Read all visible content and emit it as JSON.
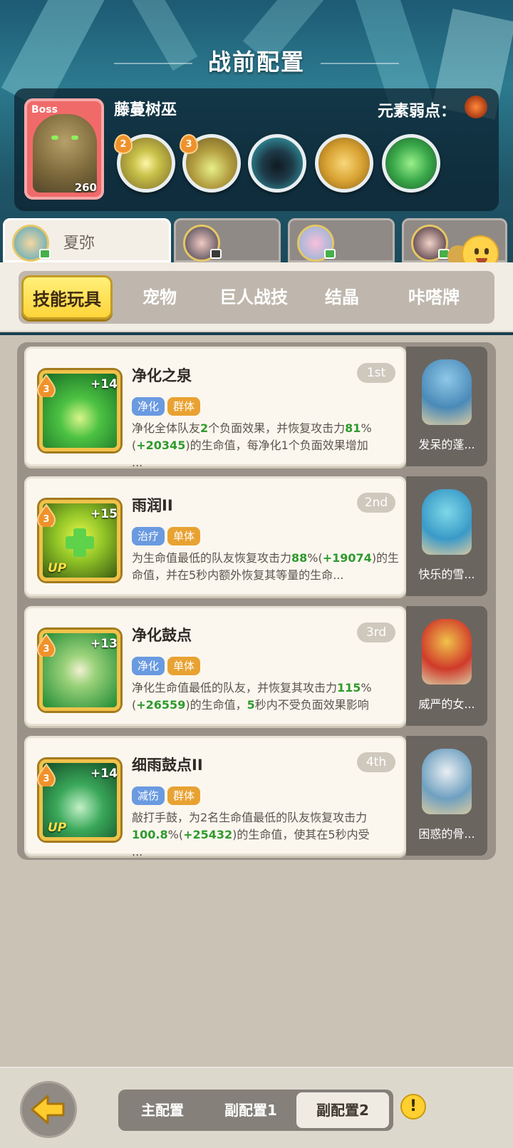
{
  "header": {
    "title": "战前配置"
  },
  "boss": {
    "tag": "Boss",
    "level": "260",
    "name": "藤蔓树巫",
    "weakness_label": "元素弱点：",
    "skill_levels": [
      "2",
      "3"
    ]
  },
  "characters": [
    {
      "name": "夏弥",
      "active": true
    },
    {
      "name": "",
      "active": false
    },
    {
      "name": "",
      "active": false
    },
    {
      "name": "",
      "active": false
    }
  ],
  "chat": {
    "label": "聊天"
  },
  "categories": [
    "技能玩具",
    "宠物",
    "巨人战技",
    "结晶",
    "咔嗒牌"
  ],
  "skills": [
    {
      "name": "净化之泉",
      "rank": "1st",
      "level": "3",
      "plus": "+14",
      "up": "",
      "tags": [
        "净化",
        "群体"
      ],
      "desc_parts": [
        "净化全体队友",
        "2",
        "个负面效果，并恢复攻击力",
        "81",
        "%(",
        "+20345",
        ")的生命值，每净化1个负面效果增加",
        "",
        "..."
      ],
      "pet": "发呆的蓬..."
    },
    {
      "name": "雨润II",
      "rank": "2nd",
      "level": "3",
      "plus": "+15",
      "up": "UP",
      "tags": [
        "治疗",
        "单体"
      ],
      "desc_parts": [
        "为生命值最低的队友恢复攻击力",
        "88",
        "%(",
        "+19074",
        ")的生命值，并在5秒内额外恢复其等量的生命",
        "",
        "..."
      ],
      "pet": "快乐的雪..."
    },
    {
      "name": "净化鼓点",
      "rank": "3rd",
      "level": "3",
      "plus": "+13",
      "up": "",
      "tags": [
        "净化",
        "单体"
      ],
      "desc_parts": [
        "净化生命值最低的队友，并恢复其攻击力",
        "115",
        "%(",
        "+26559",
        ")的生命值，",
        "5",
        "秒内不受负面效果影响"
      ],
      "pet": "威严的女..."
    },
    {
      "name": "细雨鼓点II",
      "rank": "4th",
      "level": "3",
      "plus": "+14",
      "up": "UP",
      "tags": [
        "减伤",
        "群体"
      ],
      "desc_parts": [
        "敲打手鼓，为2名生命值最低的队友恢复攻击力",
        "100.8",
        "%(",
        "+25432",
        ")的生命值，使其在5秒内受",
        "",
        "..."
      ],
      "pet": "困惑的骨..."
    }
  ],
  "footer": {
    "configs": [
      "主配置",
      "副配置1",
      "副配置2"
    ],
    "active_config": "副配置2",
    "warn_symbol": "!"
  },
  "colors": {
    "accent_yellow": "#ffd43a",
    "highlight_green": "#2f9a2c",
    "tag_blue": "#6a9ae0",
    "tag_orange": "#e8a232"
  }
}
